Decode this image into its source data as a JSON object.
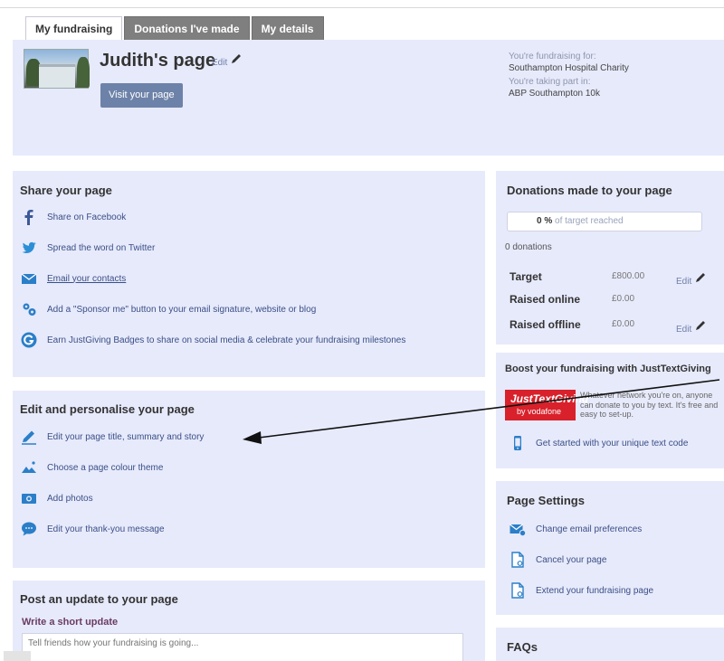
{
  "tabs": [
    "My fundraising",
    "Donations I've made",
    "My details"
  ],
  "header": {
    "page_title": "Judith's page",
    "edit_label": "Edit",
    "visit_button": "Visit your page",
    "fundraising_for_label": "You're fundraising for:",
    "fundraising_for_value": "Southampton Hospital Charity",
    "taking_part_label": "You're taking part in:",
    "taking_part_value": "ABP Southampton 10k"
  },
  "share": {
    "title": "Share your page",
    "items": [
      {
        "icon": "facebook-icon",
        "label": "Share on Facebook"
      },
      {
        "icon": "twitter-icon",
        "label": "Spread the word on Twitter"
      },
      {
        "icon": "email-icon",
        "label": "Email your contacts"
      },
      {
        "icon": "sponsor-button-icon",
        "label": "Add a \"Sponsor me\" button to your email signature, website or blog"
      },
      {
        "icon": "badge-icon",
        "label": "Earn JustGiving Badges to share on social media & celebrate your fundraising milestones"
      }
    ]
  },
  "personalise": {
    "title": "Edit and personalise your page",
    "items": [
      {
        "icon": "pencil-icon",
        "label": "Edit your page title, summary and story"
      },
      {
        "icon": "image-theme-icon",
        "label": "Choose a page colour theme"
      },
      {
        "icon": "camera-icon",
        "label": "Add photos"
      },
      {
        "icon": "speech-bubble-icon",
        "label": "Edit your thank-you message"
      }
    ]
  },
  "update": {
    "title": "Post an update to your page",
    "subtitle": "Write a short update",
    "placeholder": "Tell friends how your fundraising is going..."
  },
  "donations": {
    "title": "Donations made to your page",
    "percent": "0 %",
    "percent_suffix": "of target reached",
    "count": "0 donations",
    "target_label": "Target",
    "target_value": "£800.00",
    "raised_online_label": "Raised online",
    "raised_online_value": "£0.00",
    "raised_offline_label": "Raised offline",
    "raised_offline_value": "£0.00",
    "edit_label": "Edit"
  },
  "boost": {
    "title": "Boost your fundraising with JustTextGiving",
    "logo_line1": "JustTextGiving",
    "logo_line2": "by vodafone",
    "description": "Whatever network you're on, anyone can donate to you by text. It's free and easy to set-up.",
    "link": "Get started with your unique text code"
  },
  "settings": {
    "title": "Page Settings",
    "items": [
      {
        "icon": "email-prefs-icon",
        "label": "Change email preferences"
      },
      {
        "icon": "document-icon",
        "label": "Cancel your page"
      },
      {
        "icon": "document-icon",
        "label": "Extend your fundraising page"
      }
    ]
  },
  "faqs": {
    "title": "FAQs"
  },
  "colors": {
    "panel_bg": "#e7eafb",
    "link": "#3a4f86",
    "tab_inactive": "#7f7f7f",
    "visit_button": "#6d82a8",
    "jtg_red": "#d8212b"
  }
}
